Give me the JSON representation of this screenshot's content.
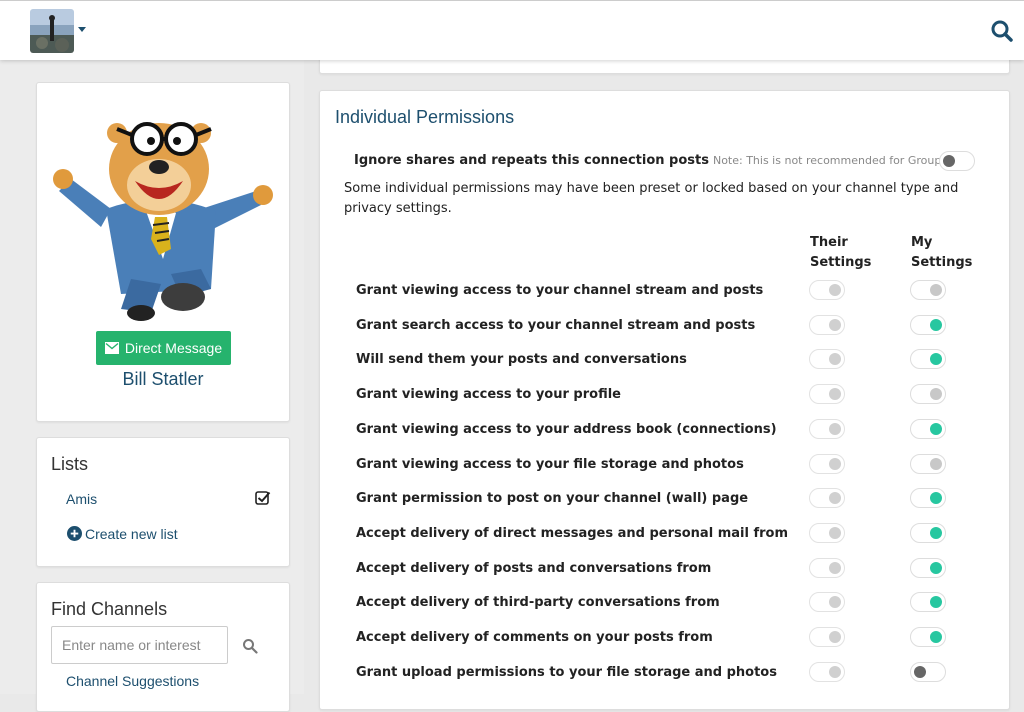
{
  "nav": {
    "avatar": "channel-avatar",
    "menu_icon": "chevron-down-icon",
    "search_icon": "search-icon"
  },
  "profile": {
    "image": "profile-photo",
    "dm_button_label": "Direct Message",
    "dm_icon": "envelope-icon",
    "name": "Bill Statler"
  },
  "lists": {
    "title": "Lists",
    "items": [
      {
        "label": "Amis",
        "checked": true
      }
    ],
    "create_label": "Create new list"
  },
  "find_channels": {
    "title": "Find Channels",
    "placeholder": "Enter name or interest",
    "suggestions_label": "Channel Suggestions"
  },
  "permissions": {
    "title": "Individual Permissions",
    "ignore_label": "Ignore shares and repeats this connection posts",
    "ignore_note": "Note: This is not recommended for Groups.",
    "ignore_on": false,
    "intro": "Some individual permissions may have been preset or locked based on your channel type and privacy settings.",
    "col_their": "Their Settings",
    "col_my": "My Settings",
    "rows": [
      {
        "label": "Grant viewing access to your channel stream and posts",
        "their": false,
        "my": false
      },
      {
        "label": "Grant search access to your channel stream and posts",
        "their": false,
        "my": true
      },
      {
        "label": "Will send them your posts and conversations",
        "their": false,
        "my": true
      },
      {
        "label": "Grant viewing access to your profile",
        "their": false,
        "my": false
      },
      {
        "label": "Grant viewing access to your address book (connections)",
        "their": false,
        "my": true
      },
      {
        "label": "Grant viewing access to your file storage and photos",
        "their": false,
        "my": false
      },
      {
        "label": "Grant permission to post on your channel (wall) page",
        "their": false,
        "my": true
      },
      {
        "label": "Accept delivery of direct messages and personal mail from",
        "their": false,
        "my": true
      },
      {
        "label": "Accept delivery of posts and conversations from",
        "their": false,
        "my": true
      },
      {
        "label": "Accept delivery of third-party conversations from",
        "their": false,
        "my": true
      },
      {
        "label": "Accept delivery of comments on your posts from",
        "their": false,
        "my": true
      },
      {
        "label": "Grant upload permissions to your file storage and photos",
        "their": false,
        "my": false
      }
    ]
  },
  "colors": {
    "accent": "#1d4f6e",
    "toggle_on": "#27c7a0",
    "button_green": "#26b36d"
  }
}
